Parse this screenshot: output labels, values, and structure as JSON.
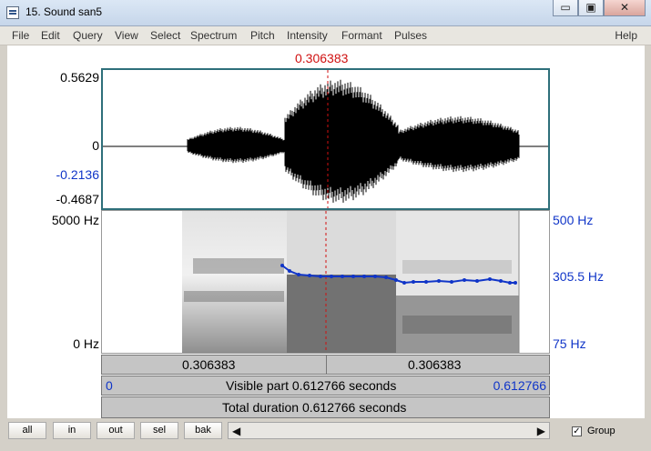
{
  "window": {
    "title": "15. Sound san5",
    "minimize_glyph": "▭",
    "maximize_glyph": "▣",
    "close_glyph": "✕"
  },
  "menu": {
    "items": [
      "File",
      "Edit",
      "Query",
      "View",
      "Select",
      "Spectrum",
      "Pitch",
      "Intensity",
      "Formant",
      "Pulses"
    ],
    "help": "Help"
  },
  "cursor": {
    "time_top": "0.306383"
  },
  "waveform": {
    "y_labels": [
      "0.5629",
      "0",
      "-0.2136",
      "-0.4687"
    ]
  },
  "spectrogram": {
    "freq_left_top": "5000 Hz",
    "freq_left_bottom": "0 Hz",
    "pitch_right_top": "500 Hz",
    "pitch_right_mid": "305.5 Hz",
    "pitch_right_bottom": "75 Hz"
  },
  "bars": {
    "left_segment": "0.306383",
    "right_segment": "0.306383",
    "visible_left": "0",
    "visible_text": "Visible part 0.612766 seconds",
    "visible_right": "0.612766",
    "total_text": "Total duration 0.612766 seconds"
  },
  "bottom": {
    "buttons": [
      "all",
      "in",
      "out",
      "sel",
      "bak"
    ],
    "group_label": "Group",
    "group_checked": "✓",
    "left_arrow": "◀",
    "right_arrow": "▶"
  },
  "colors": {
    "cursor": "#d01010",
    "pitch": "#1035c8",
    "frame": "#2e6f7a"
  }
}
